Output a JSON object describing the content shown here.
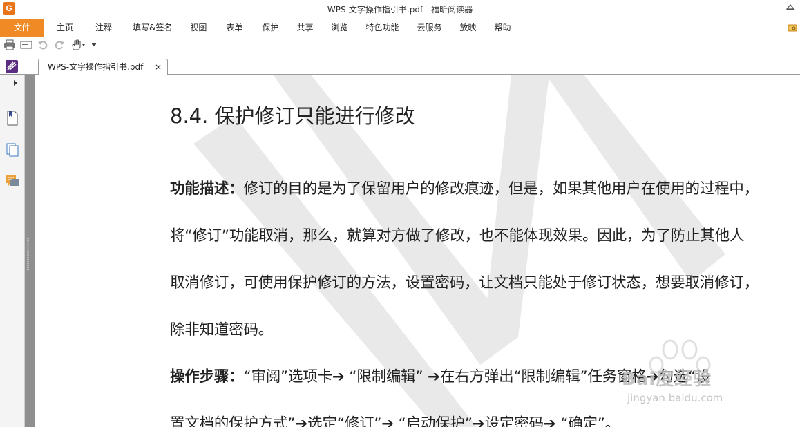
{
  "window": {
    "title": "WPS-文字操作指引书.pdf - 福昕阅读器",
    "app_icon_letter": "G"
  },
  "menu": {
    "items": [
      {
        "label": "文件",
        "active": true
      },
      {
        "label": "主页"
      },
      {
        "label": "注释"
      },
      {
        "label": "填写&签名"
      },
      {
        "label": "视图"
      },
      {
        "label": "表单"
      },
      {
        "label": "保护"
      },
      {
        "label": "共享"
      },
      {
        "label": "浏览"
      },
      {
        "label": "特色功能"
      },
      {
        "label": "云服务"
      },
      {
        "label": "放映"
      },
      {
        "label": "帮助"
      }
    ]
  },
  "quick_toolbar": {
    "icons": [
      "print-icon",
      "scan-icon",
      "undo-icon",
      "redo-icon",
      "hand-tool-icon",
      "customize-dropdown-icon"
    ]
  },
  "tabs": [
    {
      "label": "WPS-文字操作指引书.pdf",
      "close_glyph": "×"
    }
  ],
  "sidebar": {
    "icons": [
      "expand-panel-icon",
      "bookmark-icon",
      "pages-icon",
      "comments-icon"
    ]
  },
  "document": {
    "heading": "8.4.   保护修订只能进行修改",
    "paragraphs": [
      {
        "bold": "功能描述：",
        "text": "修订的目的是为了保留用户的修改痕迹，但是，如果其他用户在使用的过程中，"
      },
      {
        "bold": "",
        "text": "将“修订”功能取消，那么，就算对方做了修改，也不能体现效果。因此，为了防止其他人"
      },
      {
        "bold": "",
        "text": "取消修订，可使用保护修订的方法，设置密码，让文档只能处于修订状态，想要取消修订，"
      },
      {
        "bold": "",
        "text": "除非知道密码。"
      },
      {
        "bold": "操作步骤：",
        "text": "“审阅”选项卡➔ “限制编辑” ➔在右方弹出“限制编辑”任务窗格➔勾选“设"
      },
      {
        "bold": "",
        "text": "置文档的保护方式”➔选定“修订”➔ “启动保护”➔设定密码➔ “确定”。"
      }
    ]
  },
  "overlay_watermark": {
    "logo_text": "Bai度经验",
    "url": "jingyan.baidu.com"
  },
  "colors": {
    "file_menu_bg": "#f08a24",
    "splitter": "#8f8f8f",
    "watermark_gray": "#e4e4e4"
  }
}
